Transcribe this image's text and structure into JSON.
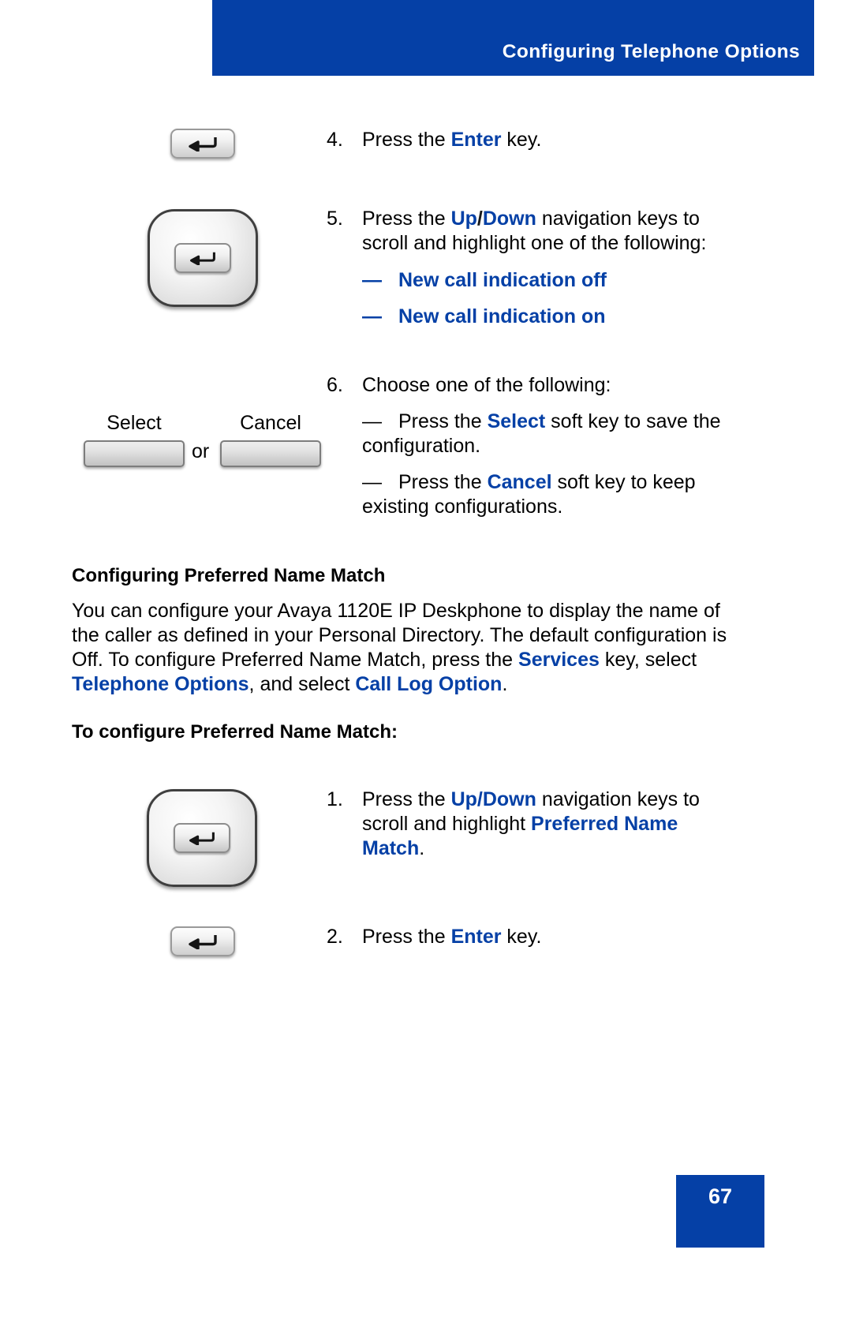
{
  "document": {
    "header_title": "Configuring Telephone Options",
    "page_number": "67",
    "accent_color": "#0540A6",
    "banner_color": "#0540A6"
  },
  "steps_top": [
    {
      "number": "4.",
      "icon": "enter-key-icon",
      "text_plain": "Press the Enter key.",
      "segments": [
        {
          "t": "Press the ",
          "style": "normal"
        },
        {
          "t": "Enter",
          "style": "accent-bold"
        },
        {
          "t": " key.",
          "style": "normal"
        }
      ]
    },
    {
      "number": "5.",
      "icon": "navigation-cluster-icon",
      "text_plain": "Press the Up/Down navigation keys to scroll and highlight one of the following:",
      "segments": [
        {
          "t": "Press the ",
          "style": "normal"
        },
        {
          "t": "Up",
          "style": "accent-bold"
        },
        {
          "t": "/",
          "style": "dark-bold"
        },
        {
          "t": "Down",
          "style": "accent-bold"
        },
        {
          "t": " navigation keys to scroll and highlight one of the following:",
          "style": "normal"
        }
      ],
      "sub_items": [
        {
          "dash": "—",
          "label": "New call indication off"
        },
        {
          "dash": "—",
          "label": "New call indication on"
        }
      ]
    },
    {
      "number": "6.",
      "icon": "softkeys-icon",
      "text_plain": "Choose one of the following:",
      "segments": [
        {
          "t": "Choose one of the following:",
          "style": "normal"
        }
      ],
      "sub_items": [
        {
          "dash": "—",
          "segments": [
            {
              "t": "Press the ",
              "style": "normal"
            },
            {
              "t": "Select",
              "style": "accent-bold"
            },
            {
              "t": " soft key to save the configuration.",
              "style": "normal"
            }
          ]
        },
        {
          "dash": "—",
          "segments": [
            {
              "t": "Press the ",
              "style": "normal"
            },
            {
              "t": "Cancel",
              "style": "accent-bold"
            },
            {
              "t": " soft key to keep existing configurations.",
              "style": "normal"
            }
          ]
        }
      ]
    }
  ],
  "softkeys": {
    "select_label": "Select",
    "cancel_label": "Cancel",
    "separator": "or"
  },
  "section": {
    "heading": "Configuring Preferred Name Match",
    "paragraph_plain": "You can configure your Avaya 1120E IP Deskphone to display the name of the caller as defined in your Personal Directory. The default configuration is Off. To configure Preferred Name Match, press the Services key, select Telephone Options, and select Call Log Option.",
    "paragraph_segments": [
      {
        "t": "You can configure your Avaya 1120E IP Deskphone to display the name of the caller as defined in your Personal Directory. The default configuration is Off. To configure Preferred Name Match, press the ",
        "style": "normal"
      },
      {
        "t": "Services",
        "style": "accent-bold"
      },
      {
        "t": " key, select ",
        "style": "normal"
      },
      {
        "t": "Telephone Options",
        "style": "accent-bold"
      },
      {
        "t": ", and select ",
        "style": "normal"
      },
      {
        "t": "Call Log Option",
        "style": "accent-bold"
      },
      {
        "t": ".",
        "style": "normal"
      }
    ],
    "procedure_heading": "To configure Preferred Name Match:"
  },
  "steps_bottom": [
    {
      "number": "1.",
      "icon": "navigation-cluster-icon",
      "text_plain": "Press the Up/Down navigation keys to scroll and highlight Preferred Name Match.",
      "segments": [
        {
          "t": "Press the ",
          "style": "normal"
        },
        {
          "t": "Up",
          "style": "accent-bold"
        },
        {
          "t": "/",
          "style": "dark-bold"
        },
        {
          "t": "Down",
          "style": "accent-bold"
        },
        {
          "t": " navigation keys to scroll and highlight ",
          "style": "normal"
        },
        {
          "t": "Preferred Name Match",
          "style": "accent-bold"
        },
        {
          "t": ".",
          "style": "normal"
        }
      ]
    },
    {
      "number": "2.",
      "icon": "enter-key-icon",
      "text_plain": "Press the Enter key.",
      "segments": [
        {
          "t": "Press the ",
          "style": "normal"
        },
        {
          "t": "Enter",
          "style": "accent-bold"
        },
        {
          "t": " key.",
          "style": "normal"
        }
      ]
    }
  ]
}
